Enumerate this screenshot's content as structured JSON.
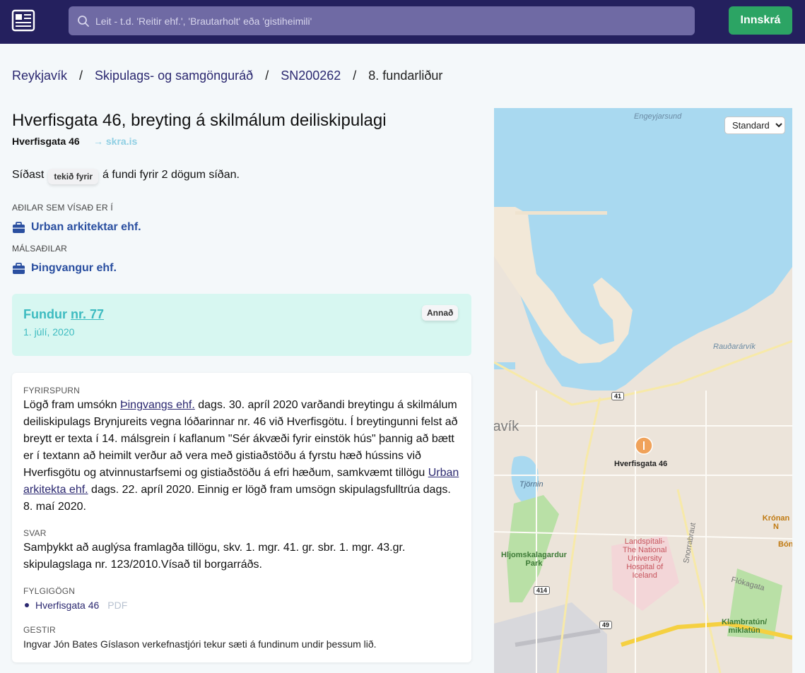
{
  "header": {
    "search_placeholder": "Leit - t.d. 'Reitir ehf.', 'Brautarholt' eða 'gistiheimili'",
    "login_label": "Innskrá"
  },
  "breadcrumb": [
    "Reykjavík",
    "Skipulags- og samgönguráð",
    "SN200262",
    "8. fundarliður"
  ],
  "item": {
    "title": "Hverfisgata 46, breyting á skilmálum deiliskipulagi",
    "address": "Hverfisgata 46",
    "skra_link": "→ skra.is",
    "last_prefix": "Síðast",
    "last_pill": "tekið fyrir",
    "last_suffix": "á fundi fyrir 2 dögum síðan."
  },
  "parties": {
    "referred_label": "AÐILAR SEM VÍSAÐ ER Í",
    "referred_name": "Urban arkitektar ehf.",
    "case_label": "MÁLSAÐILAR",
    "case_name": "Þingvangur ehf."
  },
  "meeting": {
    "prefix": "Fundur",
    "number": "nr. 77",
    "date": "1. júlí, 2020",
    "badge": "Annað"
  },
  "details": {
    "inquiry_label": "FYRIRSPURN",
    "inquiry_1": "Lögð fram umsókn ",
    "inquiry_link_1": "Þingvangs ehf.",
    "inquiry_2": " dags. 30. apríl 2020 varðandi breytingu á skilmálum deiliskipulags Brynjureits vegna lóðarinnar nr. 46 við Hverfisgötu. Í breytingunni felst að breytt er texta í 14. málsgrein í kaflanum \"Sér ákvæði fyrir einstök hús\" þannig að bætt er í textann að heimilt verður að vera með gistiaðstöðu á fyrstu hæð hússins við Hverfisgötu og atvinnustarfsemi og gistiaðstöðu á efri hæðum, samkvæmt tillögu ",
    "inquiry_link_2": "Urban arkitekta ehf.",
    "inquiry_3": " dags. 22. apríl 2020. Einnig er lögð fram umsögn skipulagsfulltrúa dags. 8. maí 2020.",
    "answer_label": "SVAR",
    "answer": "Samþykkt að auglýsa framlagða tillögu, skv. 1. mgr. 41. gr. sbr. 1. mgr. 43.gr. skipulagslaga nr. 123/2010.Vísað til borgarráðs.",
    "attachments_label": "FYLGIGÖGN",
    "attachment_name": "Hverfisgata 46",
    "attachment_type": "PDF",
    "guests_label": "GESTIR",
    "guests": "Ingvar Jón Bates Gíslason verkefnastjóri tekur sæti á fundinum undir þessum lið."
  },
  "map": {
    "style_option": "Standard",
    "labels": {
      "engey": "Engeyjarsund",
      "raudar": "Rauðarárvík",
      "reykjavik": "javík",
      "pin": "Hverfisgata 46",
      "tjornin": "Tjörnin",
      "hljom": "Hljomskalagardur\nPark",
      "landspitali": "Landspítali-\nThe National\nUniversity\nHospital of\nIceland",
      "kronan": "Krónan N",
      "bon": "Bón",
      "klambratun": "Klambratún/\nmiklatún",
      "snorrabraut": "Snorrabraut",
      "flokagata": "Flókagata",
      "r41": "41",
      "r414": "414",
      "r49": "49"
    }
  },
  "colors": {
    "header_bg": "#24205e",
    "login_bg": "#2ca464",
    "link": "#2b2870",
    "accent": "#3dbbc0",
    "meeting_bg": "#d7f7f1"
  }
}
